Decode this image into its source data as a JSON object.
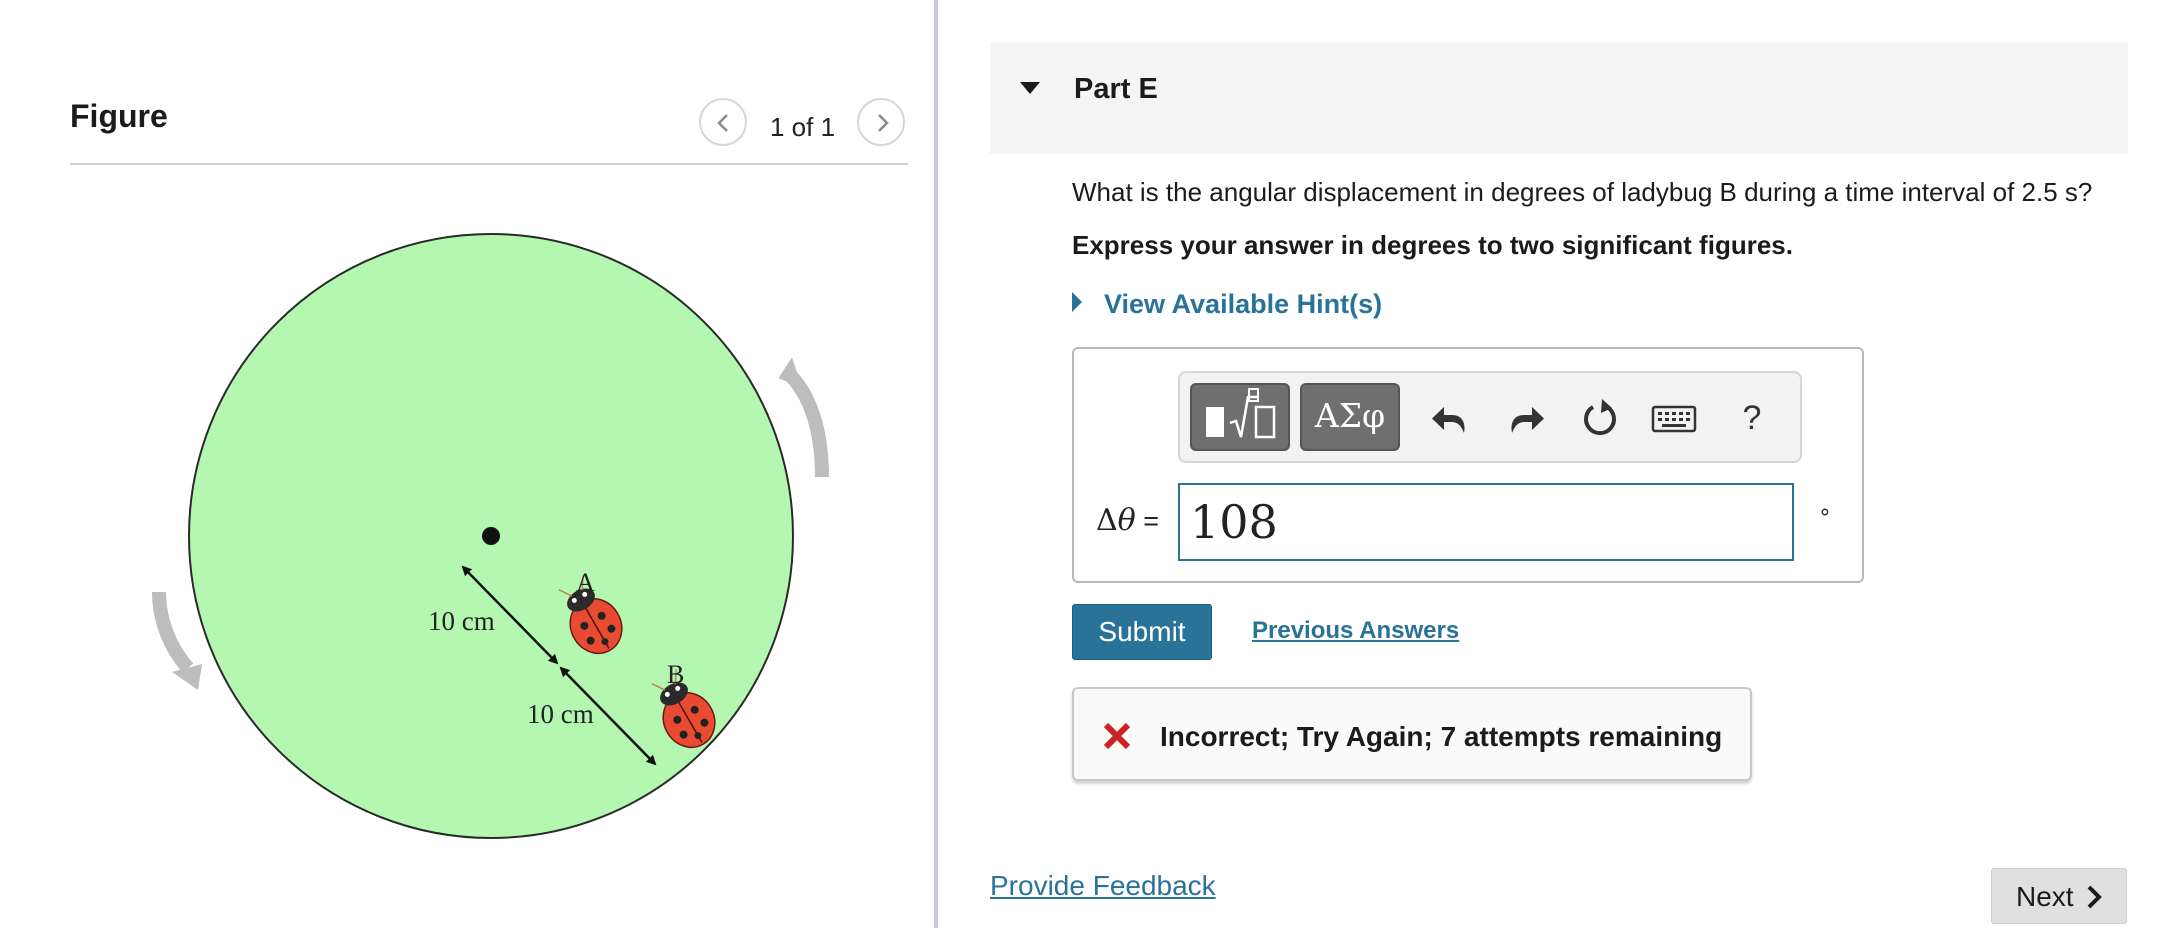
{
  "figure": {
    "title": "Figure",
    "pager": "1 of 1",
    "labels": {
      "bug_a": "A",
      "bug_b": "B",
      "dist_ab": "10 cm",
      "dist_bc": "10 cm"
    },
    "colors": {
      "disk": "#b3f7b0",
      "arrow": "#bfbfbf",
      "ladybug": "#e84a32"
    }
  },
  "part": {
    "title": "Part E"
  },
  "question": {
    "text": "What is the angular displacement in degrees of ladybug B during a time interval of 2.5 s?",
    "instruction": "Express your answer in degrees to two significant figures.",
    "hint_label": "View Available Hint(s)"
  },
  "toolbar": {
    "symbols_label": "ΑΣφ",
    "help_label": "?",
    "icons": [
      "templates-icon",
      "undo-icon",
      "redo-icon",
      "reset-icon",
      "keyboard-icon",
      "help-icon"
    ]
  },
  "answer": {
    "label_delta": "Δ",
    "label_theta": "θ",
    "label_eq": " =",
    "value": "108",
    "unit": "∘"
  },
  "actions": {
    "submit": "Submit",
    "previous_answers": "Previous Answers"
  },
  "feedback": {
    "status": "Incorrect; Try Again; 7 attempts remaining"
  },
  "footer": {
    "provide_feedback": "Provide Feedback",
    "next": "Next"
  },
  "theme": {
    "link": "#2a7398",
    "incorrect": "#cc2222",
    "panel": "#f5f5f5"
  }
}
